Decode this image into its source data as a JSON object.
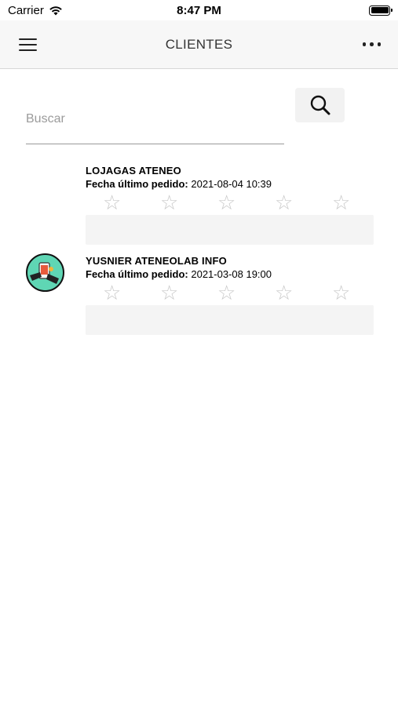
{
  "status_bar": {
    "carrier": "Carrier",
    "time": "8:47 PM"
  },
  "navbar": {
    "title": "CLIENTES"
  },
  "search": {
    "placeholder": "Buscar",
    "value": ""
  },
  "clients": [
    {
      "name": "LOJAGAS ATENEO",
      "date_label": "Fecha último pedido:",
      "date_value": "2021-08-04 10:39",
      "rating": 0,
      "has_avatar": false
    },
    {
      "name": "YUSNIER ATENEOLAB INFO",
      "date_label": "Fecha último pedido:",
      "date_value": "2021-03-08 19:00",
      "rating": 0,
      "has_avatar": true
    }
  ],
  "star_glyph": "☆",
  "colors": {
    "navbar_bg": "#f7f7f7",
    "avatar_bg": "#5fd6b4",
    "star": "#c8c8c8"
  },
  "icons": {
    "menu": "hamburger-icon",
    "more": "more-dots-icon",
    "search": "search-icon",
    "wifi": "wifi-icon",
    "battery": "battery-icon"
  }
}
